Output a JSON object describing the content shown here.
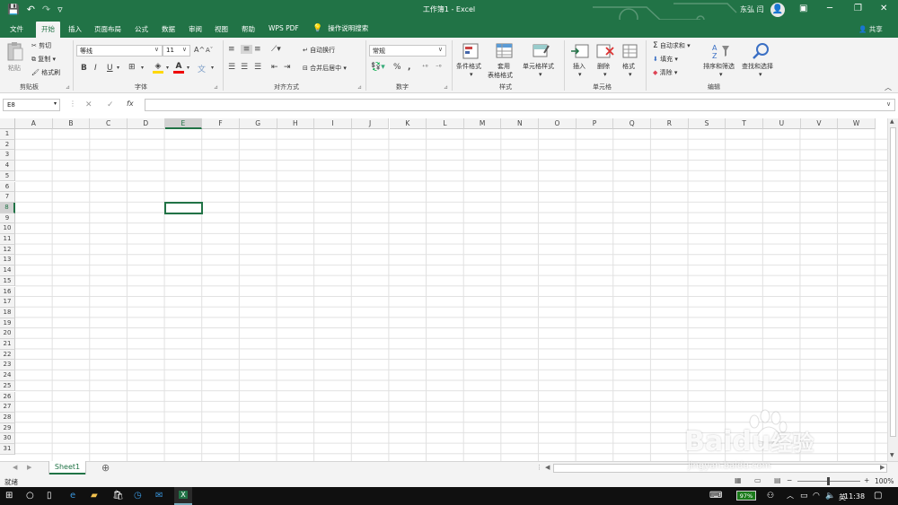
{
  "titlebar": {
    "title": "工作簿1 - Excel",
    "user": "东弘 闫",
    "avatar_glyph": "👤",
    "save_icon": "💾",
    "undo_icon": "↶",
    "redo_icon": "↷",
    "qat_more": "▿",
    "ribbon_display": "▣",
    "minimize": "─",
    "restore": "❐",
    "close": "✕"
  },
  "tabs": [
    "文件",
    "开始",
    "插入",
    "页面布局",
    "公式",
    "数据",
    "审阅",
    "视图",
    "帮助",
    "WPS PDF"
  ],
  "tellme": "操作说明搜索",
  "share": "共享",
  "ribbon": {
    "clipboard": {
      "paste": "粘贴",
      "cut": "剪切",
      "copy": "复制",
      "format_painter": "格式刷",
      "label": "剪贴板"
    },
    "font": {
      "name": "等线",
      "size": "11",
      "bold": "B",
      "italic": "I",
      "underline": "U",
      "grow": "A",
      "shrink": "A",
      "label": "字体"
    },
    "alignment": {
      "wrap": "自动换行",
      "merge": "合并后居中",
      "label": "对齐方式"
    },
    "number": {
      "format": "常规",
      "percent": "%",
      "comma": ",",
      "label": "数字"
    },
    "styles": {
      "conditional": "条件格式",
      "table_line1": "套用",
      "table_line2": "表格格式",
      "cell_styles": "单元格样式",
      "label": "样式"
    },
    "cells": {
      "insert": "插入",
      "delete": "删除",
      "format": "格式",
      "label": "单元格"
    },
    "editing": {
      "autosum": "自动求和",
      "fill": "填充",
      "clear": "清除",
      "sort_filter": "排序和筛选",
      "find_select": "查找和选择",
      "label": "编辑"
    }
  },
  "formula_bar": {
    "name_box": "E8",
    "cancel": "✕",
    "enter": "✓",
    "fx": "fx",
    "value": ""
  },
  "columns": [
    "A",
    "B",
    "C",
    "D",
    "E",
    "F",
    "G",
    "H",
    "I",
    "J",
    "K",
    "L",
    "M",
    "N",
    "O",
    "P",
    "Q",
    "R",
    "S",
    "T",
    "U",
    "V",
    "W"
  ],
  "rows": [
    "1",
    "2",
    "3",
    "4",
    "5",
    "6",
    "7",
    "8",
    "9",
    "10",
    "11",
    "12",
    "13",
    "14",
    "15",
    "16",
    "17",
    "18",
    "19",
    "20",
    "21",
    "22",
    "23",
    "24",
    "25",
    "26",
    "27",
    "28",
    "29",
    "30",
    "31"
  ],
  "selected": {
    "column": "E",
    "row": "8"
  },
  "sheets": [
    "Sheet1"
  ],
  "add_sheet": "⊕",
  "status": {
    "ready": "就绪",
    "zoom": "100%",
    "zoom_minus": "−",
    "zoom_plus": "+"
  },
  "taskbar": {
    "battery": "97%",
    "time": "11:38",
    "lang": "英"
  },
  "watermark": {
    "brand": "Baidu",
    "cn": "经验",
    "url": "jingyan.baidu.com"
  },
  "colors": {
    "accent": "#217346",
    "ribbon_bg": "#f3f3f3",
    "taskbar": "#101010"
  }
}
